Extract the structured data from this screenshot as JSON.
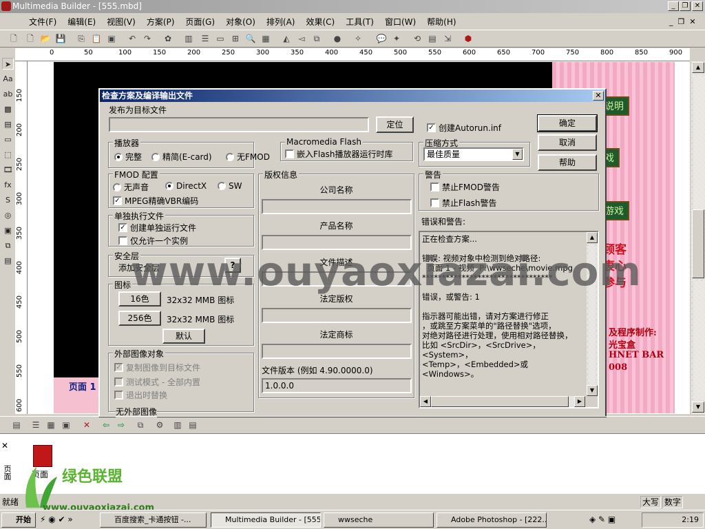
{
  "app": {
    "title": "Multimedia Builder - [555.mbd]"
  },
  "menu": [
    "文件(F)",
    "编辑(E)",
    "视图(V)",
    "方案(P)",
    "页面(G)",
    "对象(O)",
    "排列(A)",
    "效果(C)",
    "工具(T)",
    "窗口(W)",
    "帮助(H)"
  ],
  "ruler": {
    "h_labels": [
      "0",
      "50",
      "100",
      "150",
      "200",
      "250",
      "300",
      "350",
      "400",
      "450",
      "500",
      "550",
      "600",
      "650",
      "700",
      "750",
      "800",
      "850",
      "900"
    ],
    "v_labels": [
      "150",
      "200",
      "250",
      "300",
      "350",
      "400",
      "450",
      "500",
      "550",
      "600"
    ]
  },
  "canvas": {
    "page_label": "页面 1",
    "buttons": [
      "比赛说明",
      "入游戏",
      "不进游戏"
    ],
    "red_text": [
      "敬的顾客",
      "宝盒衷心",
      "您的参与"
    ],
    "credits": [
      "及程序制作:",
      "光宝盒",
      "HNET BAR",
      "008"
    ]
  },
  "dialog": {
    "title": "检查方案及编译输出文件",
    "target_label": "发布为目标文件",
    "target_value": "",
    "locate": "定位",
    "autorun": "创建Autorun.inf",
    "ok": "确定",
    "cancel": "取消",
    "help": "帮助",
    "player": {
      "label": "播放器",
      "options": [
        "完整",
        "精简(E-card)",
        "无FMOD"
      ],
      "selected": 0
    },
    "flash": {
      "label": "Macromedia Flash",
      "embed": "嵌入Flash播放器运行时库",
      "checked": false
    },
    "compression": {
      "label": "压缩方式",
      "value": "最佳质量"
    },
    "fmod": {
      "label": "FMOD 配置",
      "options": [
        "无声音",
        "DirectX",
        "SW"
      ],
      "selected": 1,
      "mpeg": "MPEG精确VBR编码",
      "mpeg_checked": true
    },
    "standalone": {
      "label": "单独执行文件",
      "create": "创建单独运行文件",
      "create_checked": true,
      "single": "仅允许一个实例",
      "single_checked": false
    },
    "security": {
      "label": "安全层",
      "value": "添加安全层",
      "help": "?"
    },
    "icon": {
      "label": "图标",
      "btn16": "16色",
      "desc16": "32x32 MMB 图标",
      "btn256": "256色",
      "desc256": "32x32 MMB 图标",
      "default": "默认"
    },
    "external": {
      "label": "外部图像对象",
      "copy": "复制图像到目标文件",
      "test": "测试模式 - 全部内置",
      "exit": "退出时替换",
      "status": "无外部图像"
    },
    "copyright": {
      "label": "版权信息",
      "fields": [
        {
          "label": "公司名称",
          "value": ""
        },
        {
          "label": "产品名称",
          "value": ""
        },
        {
          "label": "文件描述",
          "value": ""
        },
        {
          "label": "法定版权",
          "value": ""
        },
        {
          "label": "法定商标",
          "value": ""
        }
      ],
      "version_label": "文件版本 (例如 4.90.0000.0)",
      "version_value": "1.0.0.0"
    },
    "warnings": {
      "label": "警告",
      "fmod": "禁止FMOD警告",
      "flash": "禁止Flash警告"
    },
    "errors": {
      "label": "错误和警告:",
      "log": "正在检查方案...\n\n错误: 视频对象中检测到绝对路径:\n  页面 1 - 视频  P:\\wwseche\\movie.mpg\n*********************************\n\n错误，或警告: 1\n\n指示器可能出错，请对方案进行修正\n，或跳至方案菜单的\"路径替换\"选项，\n对绝对路径进行处理，使用相对路径替换，\n比如 <SrcDir>，<SrcDrive>，<System>，\n<Temp>，<Embedded>或<Windows>。"
    }
  },
  "watermark": "www.ouyaoxiazai.com",
  "logo": {
    "name": "绿色联盟",
    "url": "www.ouyaoxiazai.com"
  },
  "pages_panel": {
    "thumb_label": "页面",
    "side_label": "页面"
  },
  "status": {
    "text": "就绪",
    "caps": "大写",
    "num": "数字"
  },
  "taskbar": {
    "start": "开始",
    "tasks": [
      "百度搜索_卡通按钮 -...",
      "Multimedia Builder - [555...",
      "wwseche",
      "Adobe Photoshop - [222..."
    ],
    "active": 1,
    "time": "2:19"
  },
  "colors": {
    "dialog_title": "#0a246a",
    "canvas_bg": "#000000",
    "page_pink": "#f3a9c4"
  }
}
